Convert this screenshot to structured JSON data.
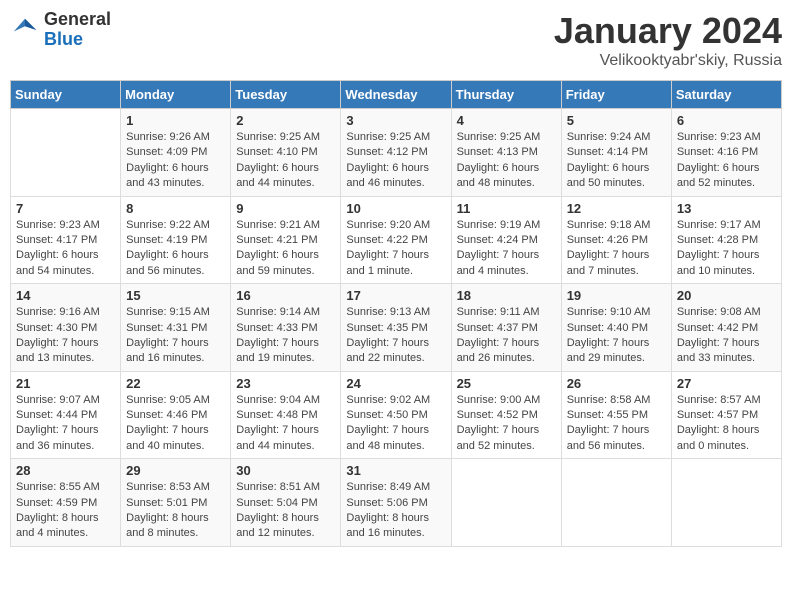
{
  "logo": {
    "text_general": "General",
    "text_blue": "Blue"
  },
  "header": {
    "title": "January 2024",
    "subtitle": "Velikooktyabr'skiy, Russia"
  },
  "days_of_week": [
    "Sunday",
    "Monday",
    "Tuesday",
    "Wednesday",
    "Thursday",
    "Friday",
    "Saturday"
  ],
  "weeks": [
    [
      {
        "day": "",
        "sunrise": "",
        "sunset": "",
        "daylight": ""
      },
      {
        "day": "1",
        "sunrise": "Sunrise: 9:26 AM",
        "sunset": "Sunset: 4:09 PM",
        "daylight": "Daylight: 6 hours and 43 minutes."
      },
      {
        "day": "2",
        "sunrise": "Sunrise: 9:25 AM",
        "sunset": "Sunset: 4:10 PM",
        "daylight": "Daylight: 6 hours and 44 minutes."
      },
      {
        "day": "3",
        "sunrise": "Sunrise: 9:25 AM",
        "sunset": "Sunset: 4:12 PM",
        "daylight": "Daylight: 6 hours and 46 minutes."
      },
      {
        "day": "4",
        "sunrise": "Sunrise: 9:25 AM",
        "sunset": "Sunset: 4:13 PM",
        "daylight": "Daylight: 6 hours and 48 minutes."
      },
      {
        "day": "5",
        "sunrise": "Sunrise: 9:24 AM",
        "sunset": "Sunset: 4:14 PM",
        "daylight": "Daylight: 6 hours and 50 minutes."
      },
      {
        "day": "6",
        "sunrise": "Sunrise: 9:23 AM",
        "sunset": "Sunset: 4:16 PM",
        "daylight": "Daylight: 6 hours and 52 minutes."
      }
    ],
    [
      {
        "day": "7",
        "sunrise": "Sunrise: 9:23 AM",
        "sunset": "Sunset: 4:17 PM",
        "daylight": "Daylight: 6 hours and 54 minutes."
      },
      {
        "day": "8",
        "sunrise": "Sunrise: 9:22 AM",
        "sunset": "Sunset: 4:19 PM",
        "daylight": "Daylight: 6 hours and 56 minutes."
      },
      {
        "day": "9",
        "sunrise": "Sunrise: 9:21 AM",
        "sunset": "Sunset: 4:21 PM",
        "daylight": "Daylight: 6 hours and 59 minutes."
      },
      {
        "day": "10",
        "sunrise": "Sunrise: 9:20 AM",
        "sunset": "Sunset: 4:22 PM",
        "daylight": "Daylight: 7 hours and 1 minute."
      },
      {
        "day": "11",
        "sunrise": "Sunrise: 9:19 AM",
        "sunset": "Sunset: 4:24 PM",
        "daylight": "Daylight: 7 hours and 4 minutes."
      },
      {
        "day": "12",
        "sunrise": "Sunrise: 9:18 AM",
        "sunset": "Sunset: 4:26 PM",
        "daylight": "Daylight: 7 hours and 7 minutes."
      },
      {
        "day": "13",
        "sunrise": "Sunrise: 9:17 AM",
        "sunset": "Sunset: 4:28 PM",
        "daylight": "Daylight: 7 hours and 10 minutes."
      }
    ],
    [
      {
        "day": "14",
        "sunrise": "Sunrise: 9:16 AM",
        "sunset": "Sunset: 4:30 PM",
        "daylight": "Daylight: 7 hours and 13 minutes."
      },
      {
        "day": "15",
        "sunrise": "Sunrise: 9:15 AM",
        "sunset": "Sunset: 4:31 PM",
        "daylight": "Daylight: 7 hours and 16 minutes."
      },
      {
        "day": "16",
        "sunrise": "Sunrise: 9:14 AM",
        "sunset": "Sunset: 4:33 PM",
        "daylight": "Daylight: 7 hours and 19 minutes."
      },
      {
        "day": "17",
        "sunrise": "Sunrise: 9:13 AM",
        "sunset": "Sunset: 4:35 PM",
        "daylight": "Daylight: 7 hours and 22 minutes."
      },
      {
        "day": "18",
        "sunrise": "Sunrise: 9:11 AM",
        "sunset": "Sunset: 4:37 PM",
        "daylight": "Daylight: 7 hours and 26 minutes."
      },
      {
        "day": "19",
        "sunrise": "Sunrise: 9:10 AM",
        "sunset": "Sunset: 4:40 PM",
        "daylight": "Daylight: 7 hours and 29 minutes."
      },
      {
        "day": "20",
        "sunrise": "Sunrise: 9:08 AM",
        "sunset": "Sunset: 4:42 PM",
        "daylight": "Daylight: 7 hours and 33 minutes."
      }
    ],
    [
      {
        "day": "21",
        "sunrise": "Sunrise: 9:07 AM",
        "sunset": "Sunset: 4:44 PM",
        "daylight": "Daylight: 7 hours and 36 minutes."
      },
      {
        "day": "22",
        "sunrise": "Sunrise: 9:05 AM",
        "sunset": "Sunset: 4:46 PM",
        "daylight": "Daylight: 7 hours and 40 minutes."
      },
      {
        "day": "23",
        "sunrise": "Sunrise: 9:04 AM",
        "sunset": "Sunset: 4:48 PM",
        "daylight": "Daylight: 7 hours and 44 minutes."
      },
      {
        "day": "24",
        "sunrise": "Sunrise: 9:02 AM",
        "sunset": "Sunset: 4:50 PM",
        "daylight": "Daylight: 7 hours and 48 minutes."
      },
      {
        "day": "25",
        "sunrise": "Sunrise: 9:00 AM",
        "sunset": "Sunset: 4:52 PM",
        "daylight": "Daylight: 7 hours and 52 minutes."
      },
      {
        "day": "26",
        "sunrise": "Sunrise: 8:58 AM",
        "sunset": "Sunset: 4:55 PM",
        "daylight": "Daylight: 7 hours and 56 minutes."
      },
      {
        "day": "27",
        "sunrise": "Sunrise: 8:57 AM",
        "sunset": "Sunset: 4:57 PM",
        "daylight": "Daylight: 8 hours and 0 minutes."
      }
    ],
    [
      {
        "day": "28",
        "sunrise": "Sunrise: 8:55 AM",
        "sunset": "Sunset: 4:59 PM",
        "daylight": "Daylight: 8 hours and 4 minutes."
      },
      {
        "day": "29",
        "sunrise": "Sunrise: 8:53 AM",
        "sunset": "Sunset: 5:01 PM",
        "daylight": "Daylight: 8 hours and 8 minutes."
      },
      {
        "day": "30",
        "sunrise": "Sunrise: 8:51 AM",
        "sunset": "Sunset: 5:04 PM",
        "daylight": "Daylight: 8 hours and 12 minutes."
      },
      {
        "day": "31",
        "sunrise": "Sunrise: 8:49 AM",
        "sunset": "Sunset: 5:06 PM",
        "daylight": "Daylight: 8 hours and 16 minutes."
      },
      {
        "day": "",
        "sunrise": "",
        "sunset": "",
        "daylight": ""
      },
      {
        "day": "",
        "sunrise": "",
        "sunset": "",
        "daylight": ""
      },
      {
        "day": "",
        "sunrise": "",
        "sunset": "",
        "daylight": ""
      }
    ]
  ]
}
